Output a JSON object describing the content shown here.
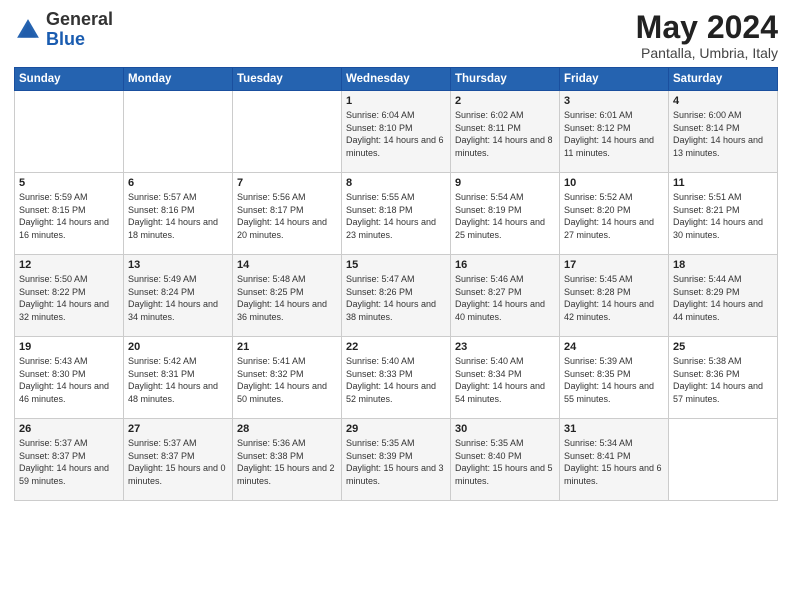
{
  "header": {
    "logo_general": "General",
    "logo_blue": "Blue",
    "month_title": "May 2024",
    "subtitle": "Pantalla, Umbria, Italy"
  },
  "columns": [
    "Sunday",
    "Monday",
    "Tuesday",
    "Wednesday",
    "Thursday",
    "Friday",
    "Saturday"
  ],
  "weeks": [
    [
      {
        "day": "",
        "sunrise": "",
        "sunset": "",
        "daylight": ""
      },
      {
        "day": "",
        "sunrise": "",
        "sunset": "",
        "daylight": ""
      },
      {
        "day": "",
        "sunrise": "",
        "sunset": "",
        "daylight": ""
      },
      {
        "day": "1",
        "sunrise": "Sunrise: 6:04 AM",
        "sunset": "Sunset: 8:10 PM",
        "daylight": "Daylight: 14 hours and 6 minutes."
      },
      {
        "day": "2",
        "sunrise": "Sunrise: 6:02 AM",
        "sunset": "Sunset: 8:11 PM",
        "daylight": "Daylight: 14 hours and 8 minutes."
      },
      {
        "day": "3",
        "sunrise": "Sunrise: 6:01 AM",
        "sunset": "Sunset: 8:12 PM",
        "daylight": "Daylight: 14 hours and 11 minutes."
      },
      {
        "day": "4",
        "sunrise": "Sunrise: 6:00 AM",
        "sunset": "Sunset: 8:14 PM",
        "daylight": "Daylight: 14 hours and 13 minutes."
      }
    ],
    [
      {
        "day": "5",
        "sunrise": "Sunrise: 5:59 AM",
        "sunset": "Sunset: 8:15 PM",
        "daylight": "Daylight: 14 hours and 16 minutes."
      },
      {
        "day": "6",
        "sunrise": "Sunrise: 5:57 AM",
        "sunset": "Sunset: 8:16 PM",
        "daylight": "Daylight: 14 hours and 18 minutes."
      },
      {
        "day": "7",
        "sunrise": "Sunrise: 5:56 AM",
        "sunset": "Sunset: 8:17 PM",
        "daylight": "Daylight: 14 hours and 20 minutes."
      },
      {
        "day": "8",
        "sunrise": "Sunrise: 5:55 AM",
        "sunset": "Sunset: 8:18 PM",
        "daylight": "Daylight: 14 hours and 23 minutes."
      },
      {
        "day": "9",
        "sunrise": "Sunrise: 5:54 AM",
        "sunset": "Sunset: 8:19 PM",
        "daylight": "Daylight: 14 hours and 25 minutes."
      },
      {
        "day": "10",
        "sunrise": "Sunrise: 5:52 AM",
        "sunset": "Sunset: 8:20 PM",
        "daylight": "Daylight: 14 hours and 27 minutes."
      },
      {
        "day": "11",
        "sunrise": "Sunrise: 5:51 AM",
        "sunset": "Sunset: 8:21 PM",
        "daylight": "Daylight: 14 hours and 30 minutes."
      }
    ],
    [
      {
        "day": "12",
        "sunrise": "Sunrise: 5:50 AM",
        "sunset": "Sunset: 8:22 PM",
        "daylight": "Daylight: 14 hours and 32 minutes."
      },
      {
        "day": "13",
        "sunrise": "Sunrise: 5:49 AM",
        "sunset": "Sunset: 8:24 PM",
        "daylight": "Daylight: 14 hours and 34 minutes."
      },
      {
        "day": "14",
        "sunrise": "Sunrise: 5:48 AM",
        "sunset": "Sunset: 8:25 PM",
        "daylight": "Daylight: 14 hours and 36 minutes."
      },
      {
        "day": "15",
        "sunrise": "Sunrise: 5:47 AM",
        "sunset": "Sunset: 8:26 PM",
        "daylight": "Daylight: 14 hours and 38 minutes."
      },
      {
        "day": "16",
        "sunrise": "Sunrise: 5:46 AM",
        "sunset": "Sunset: 8:27 PM",
        "daylight": "Daylight: 14 hours and 40 minutes."
      },
      {
        "day": "17",
        "sunrise": "Sunrise: 5:45 AM",
        "sunset": "Sunset: 8:28 PM",
        "daylight": "Daylight: 14 hours and 42 minutes."
      },
      {
        "day": "18",
        "sunrise": "Sunrise: 5:44 AM",
        "sunset": "Sunset: 8:29 PM",
        "daylight": "Daylight: 14 hours and 44 minutes."
      }
    ],
    [
      {
        "day": "19",
        "sunrise": "Sunrise: 5:43 AM",
        "sunset": "Sunset: 8:30 PM",
        "daylight": "Daylight: 14 hours and 46 minutes."
      },
      {
        "day": "20",
        "sunrise": "Sunrise: 5:42 AM",
        "sunset": "Sunset: 8:31 PM",
        "daylight": "Daylight: 14 hours and 48 minutes."
      },
      {
        "day": "21",
        "sunrise": "Sunrise: 5:41 AM",
        "sunset": "Sunset: 8:32 PM",
        "daylight": "Daylight: 14 hours and 50 minutes."
      },
      {
        "day": "22",
        "sunrise": "Sunrise: 5:40 AM",
        "sunset": "Sunset: 8:33 PM",
        "daylight": "Daylight: 14 hours and 52 minutes."
      },
      {
        "day": "23",
        "sunrise": "Sunrise: 5:40 AM",
        "sunset": "Sunset: 8:34 PM",
        "daylight": "Daylight: 14 hours and 54 minutes."
      },
      {
        "day": "24",
        "sunrise": "Sunrise: 5:39 AM",
        "sunset": "Sunset: 8:35 PM",
        "daylight": "Daylight: 14 hours and 55 minutes."
      },
      {
        "day": "25",
        "sunrise": "Sunrise: 5:38 AM",
        "sunset": "Sunset: 8:36 PM",
        "daylight": "Daylight: 14 hours and 57 minutes."
      }
    ],
    [
      {
        "day": "26",
        "sunrise": "Sunrise: 5:37 AM",
        "sunset": "Sunset: 8:37 PM",
        "daylight": "Daylight: 14 hours and 59 minutes."
      },
      {
        "day": "27",
        "sunrise": "Sunrise: 5:37 AM",
        "sunset": "Sunset: 8:37 PM",
        "daylight": "Daylight: 15 hours and 0 minutes."
      },
      {
        "day": "28",
        "sunrise": "Sunrise: 5:36 AM",
        "sunset": "Sunset: 8:38 PM",
        "daylight": "Daylight: 15 hours and 2 minutes."
      },
      {
        "day": "29",
        "sunrise": "Sunrise: 5:35 AM",
        "sunset": "Sunset: 8:39 PM",
        "daylight": "Daylight: 15 hours and 3 minutes."
      },
      {
        "day": "30",
        "sunrise": "Sunrise: 5:35 AM",
        "sunset": "Sunset: 8:40 PM",
        "daylight": "Daylight: 15 hours and 5 minutes."
      },
      {
        "day": "31",
        "sunrise": "Sunrise: 5:34 AM",
        "sunset": "Sunset: 8:41 PM",
        "daylight": "Daylight: 15 hours and 6 minutes."
      },
      {
        "day": "",
        "sunrise": "",
        "sunset": "",
        "daylight": ""
      }
    ]
  ]
}
